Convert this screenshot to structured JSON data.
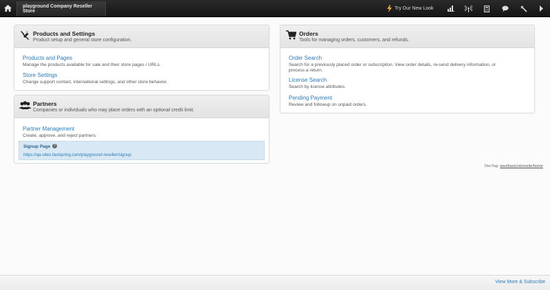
{
  "topbar": {
    "store_name": "playground Company Reseller Store",
    "new_look_label": "Try Our New Look",
    "icons": [
      "home-icon",
      "lightning-icon",
      "bar-chart-icon",
      "broadcast-icon",
      "calculator-icon",
      "chat-icon",
      "tools-icon",
      "chevron-right-icon"
    ]
  },
  "products_card": {
    "title": "Products and Settings",
    "description": "Product setup and general store configuration.",
    "items": [
      {
        "label": "Products and Pages",
        "desc": "Manage the products available for sale and their store pages / URLs."
      },
      {
        "label": "Store Settings",
        "desc": "Change support contact, international settings, and other store behavior."
      }
    ]
  },
  "partners_card": {
    "title": "Partners",
    "description": "Companies or individuals who may place orders with an optional credit limit.",
    "items": [
      {
        "label": "Partner Management",
        "desc": "Create, approve, and reject partners."
      }
    ],
    "signup": {
      "title": "Signup Page",
      "url": "https://qa-sites.fastspring.com/playground-reseller/signup"
    }
  },
  "orders_card": {
    "title": "Orders",
    "description": "Tools for managing orders, customers, and refunds.",
    "items": [
      {
        "label": "Order Search",
        "desc1": "Search for a previously placed order or subscription. View order details, re-send delivery information, or",
        "desc2": "process a return."
      },
      {
        "label": "License Search",
        "desc1": "Search by license attributes.",
        "desc2": ""
      },
      {
        "label": "Pending Payment",
        "desc1": "Review and followup on unpaid orders.",
        "desc2": ""
      }
    ]
  },
  "doctag": {
    "label": "DocTag:",
    "value": "aws/basic/storesite/home"
  },
  "footer": {
    "view_more": "View More & Subscribe"
  },
  "colors": {
    "link": "#2a7ab8",
    "topbar": "#1c1c1c",
    "signup_bg": "#d8e9f5"
  }
}
